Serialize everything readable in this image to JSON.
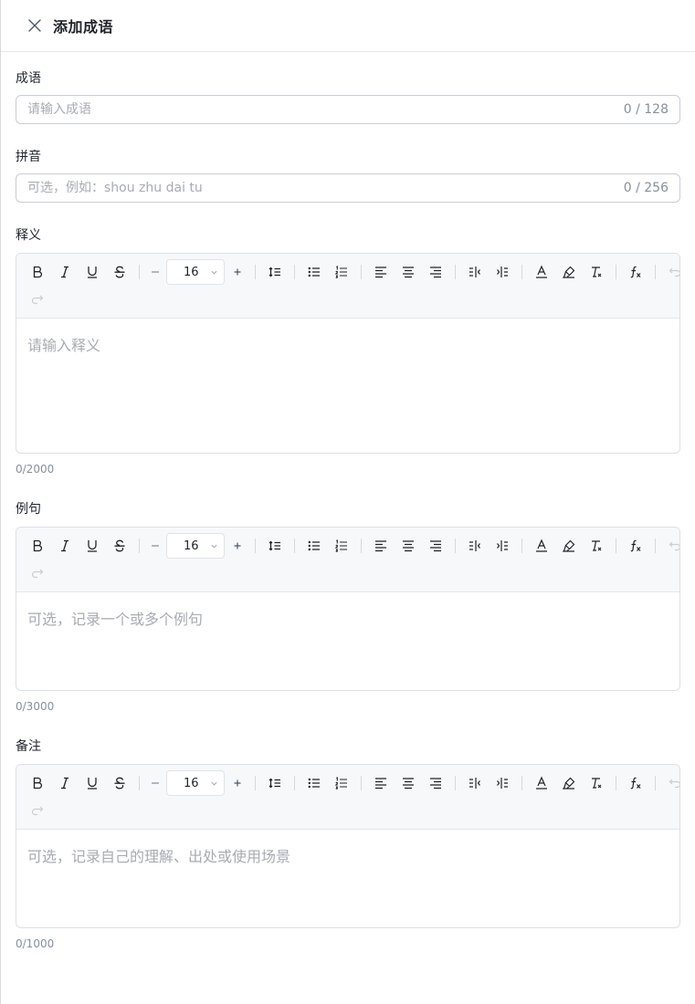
{
  "header": {
    "title": "添加成语",
    "close_icon": "close-icon"
  },
  "fields": {
    "idiom": {
      "label": "成语",
      "placeholder": "请输入成语",
      "value": "",
      "counter": "0 / 128"
    },
    "pinyin": {
      "label": "拼音",
      "placeholder": "可选，例如：shou zhu dai tu",
      "value": "",
      "counter": "0 / 256"
    },
    "definition": {
      "label": "释义",
      "placeholder": "请输入释义",
      "font_size": "16",
      "char_count": "0/2000"
    },
    "example": {
      "label": "例句",
      "placeholder": "可选，记录一个或多个例句",
      "font_size": "16",
      "char_count": "0/3000"
    },
    "notes": {
      "label": "备注",
      "placeholder": "可选，记录自己的理解、出处或使用场景",
      "font_size": "16",
      "char_count": "0/1000"
    }
  },
  "toolbar_icons": [
    "bold-icon",
    "italic-icon",
    "underline-icon",
    "strikethrough-icon",
    "font-size-decrease-icon",
    "font-size-increase-icon",
    "line-height-icon",
    "bullet-list-icon",
    "numbered-list-icon",
    "align-left-icon",
    "align-center-icon",
    "align-right-icon",
    "outdent-icon",
    "indent-icon",
    "font-color-icon",
    "highlight-icon",
    "clear-format-icon",
    "formula-icon",
    "undo-icon",
    "redo-icon"
  ],
  "colors": {
    "text": "#1f2329",
    "placeholder": "#a8abb2",
    "border": "#c9cdd4",
    "toolbar_bg": "#f7f8fa",
    "muted": "#86909c"
  }
}
